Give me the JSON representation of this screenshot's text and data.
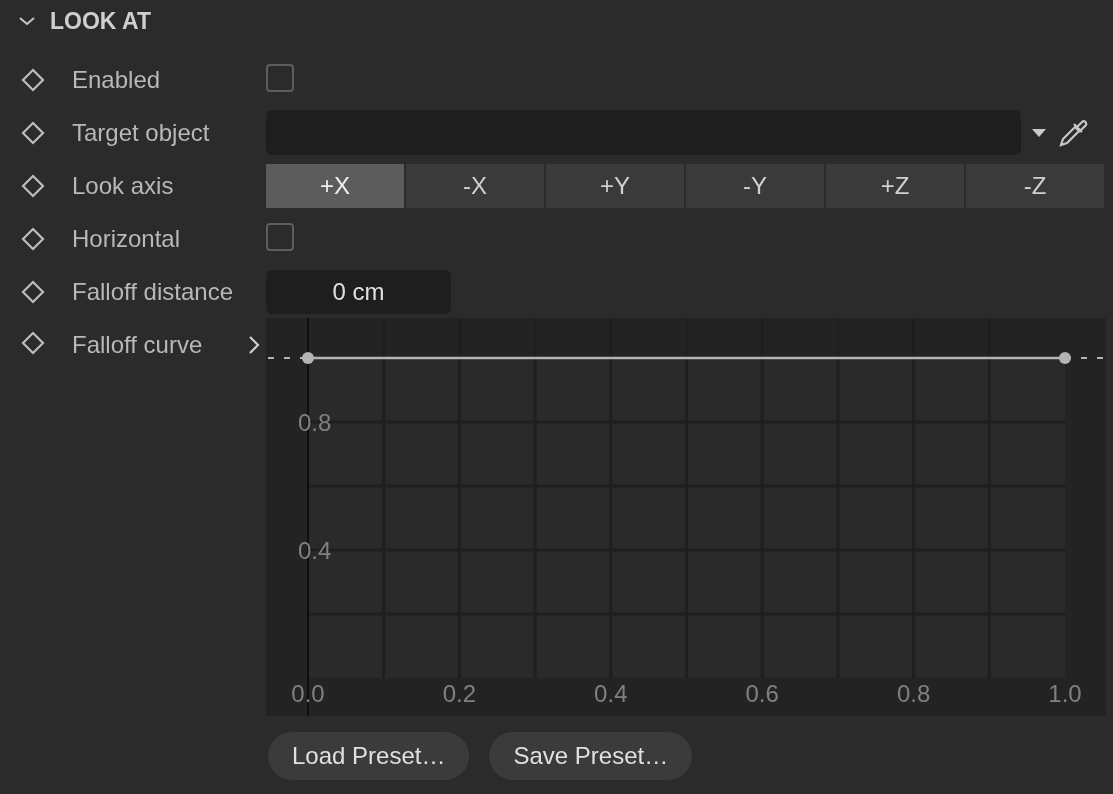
{
  "section": {
    "title": "LOOK AT",
    "expanded": true
  },
  "properties": [
    {
      "kind": "checkbox",
      "label": "Enabled",
      "checked": false
    },
    {
      "kind": "link",
      "label": "Target object"
    },
    {
      "kind": "segmented",
      "label": "Look axis",
      "options": [
        {
          "label": "+X",
          "selected": true
        },
        {
          "label": "-X",
          "selected": false
        },
        {
          "label": "+Y",
          "selected": false
        },
        {
          "label": "-Y",
          "selected": false
        },
        {
          "label": "+Z",
          "selected": false
        },
        {
          "label": "-Z",
          "selected": false
        }
      ]
    },
    {
      "kind": "checkbox",
      "label": "Horizontal",
      "checked": false
    },
    {
      "kind": "number",
      "label": "Falloff distance",
      "value": "0 cm"
    },
    {
      "kind": "curve",
      "label": "Falloff curve",
      "chart_data": {
        "type": "line",
        "grid": true,
        "x": [
          0,
          1
        ],
        "series": [
          {
            "color": "#b4b4b4",
            "marker": true,
            "values": [
              1,
              1
            ]
          }
        ],
        "xlim": [
          0,
          1
        ],
        "ylim": [
          0,
          1
        ],
        "xticks": [
          {
            "value": 0,
            "label": "0.0"
          },
          {
            "value": 0.2,
            "label": "0.2"
          },
          {
            "value": 0.4,
            "label": "0.4"
          },
          {
            "value": 0.6,
            "label": "0.6"
          },
          {
            "value": 0.8,
            "label": "0.8"
          },
          {
            "value": 1,
            "label": "1.0"
          }
        ],
        "yticks": [
          {
            "value": 0.4,
            "label": "0.4"
          },
          {
            "value": 0.8,
            "label": "0.8"
          }
        ]
      }
    }
  ],
  "buttons": [
    "Load Preset…",
    "Save Preset…"
  ]
}
